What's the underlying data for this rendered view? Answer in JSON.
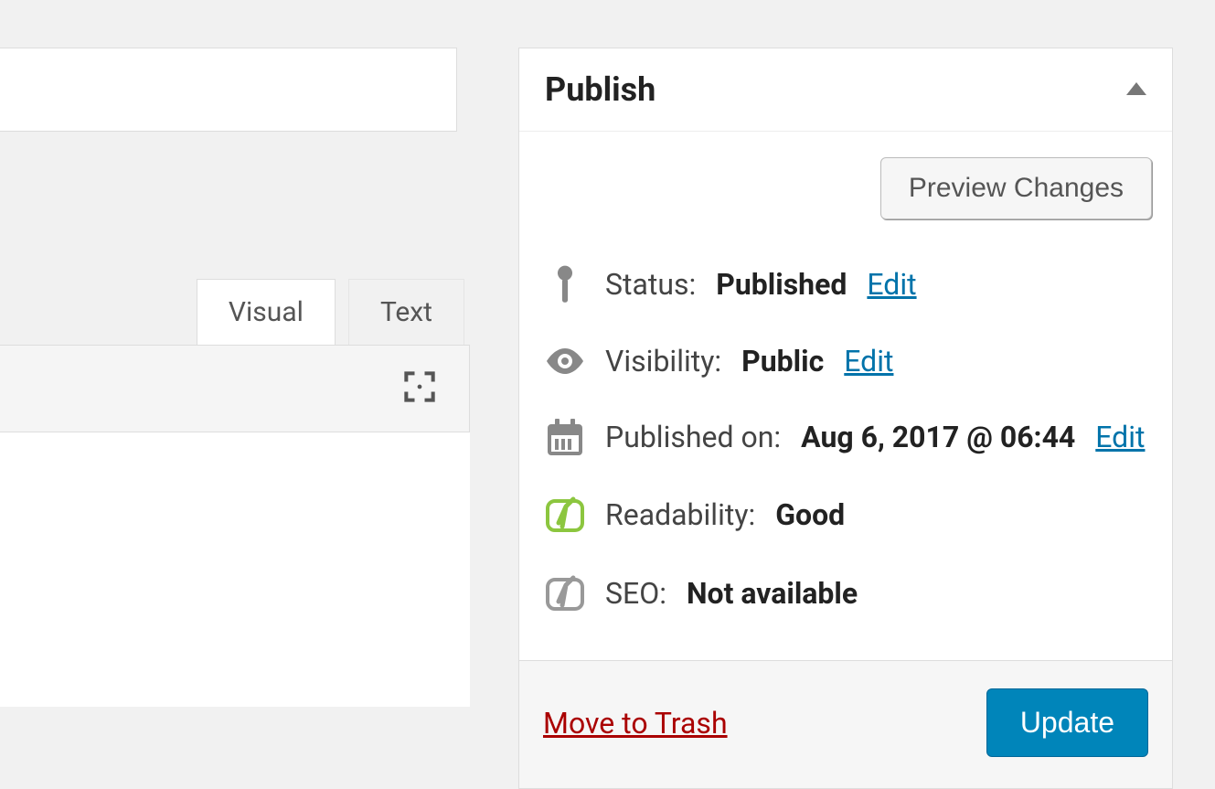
{
  "editor": {
    "tabs": {
      "visual": "Visual",
      "text": "Text"
    }
  },
  "publish": {
    "title": "Publish",
    "preview_button": "Preview Changes",
    "status": {
      "label": "Status:",
      "value": "Published",
      "edit": "Edit"
    },
    "visibility": {
      "label": "Visibility:",
      "value": "Public",
      "edit": "Edit"
    },
    "published_on": {
      "label": "Published on:",
      "value": "Aug 6, 2017 @ 06:44",
      "edit": "Edit"
    },
    "readability": {
      "label": "Readability:",
      "value": "Good"
    },
    "seo": {
      "label": "SEO:",
      "value": "Not available"
    },
    "trash": "Move to Trash",
    "update_button": "Update"
  }
}
